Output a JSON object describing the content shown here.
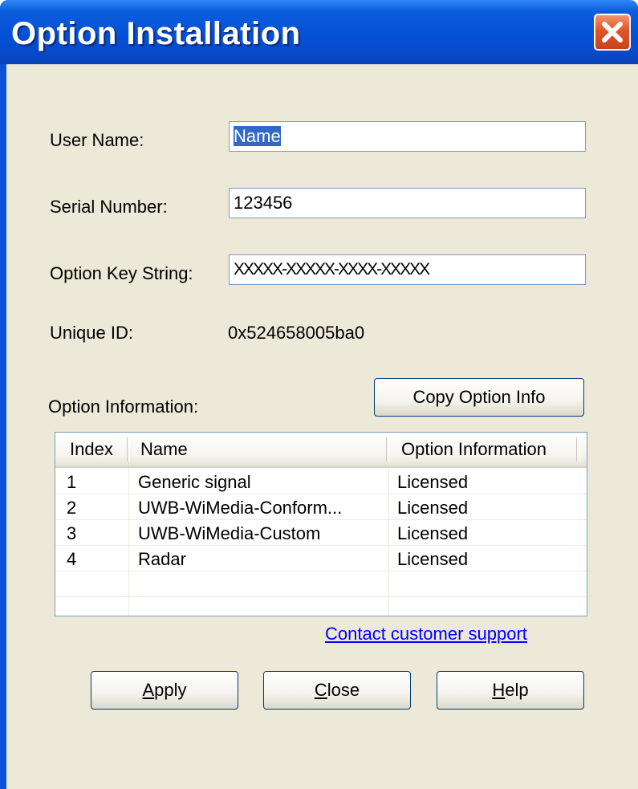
{
  "window": {
    "title": "Option Installation"
  },
  "form": {
    "user_name_label": "User Name:",
    "user_name_value": "Name",
    "serial_label": "Serial Number:",
    "serial_value": "123456",
    "key_label": "Option Key String:",
    "key_value": "XXXXX-XXXXX-XXXX-XXXXX",
    "unique_id_label": "Unique ID:",
    "unique_id_value": "0x524658005ba0",
    "option_info_label": "Option Information:"
  },
  "copy_button": "Copy Option Info",
  "table": {
    "headers": [
      "Index",
      "Name",
      "Option Information"
    ],
    "rows": [
      [
        "1",
        "Generic signal",
        "Licensed"
      ],
      [
        "2",
        "UWB-WiMedia-Conform...",
        "Licensed"
      ],
      [
        "3",
        "UWB-WiMedia-Custom",
        "Licensed"
      ],
      [
        "4",
        "Radar",
        "Licensed"
      ]
    ]
  },
  "support_link": "Contact customer support",
  "buttons": {
    "apply": {
      "mnemonic": "A",
      "rest": "pply"
    },
    "close": {
      "mnemonic": "C",
      "rest": "lose"
    },
    "help": {
      "mnemonic": "H",
      "rest": "elp"
    }
  }
}
